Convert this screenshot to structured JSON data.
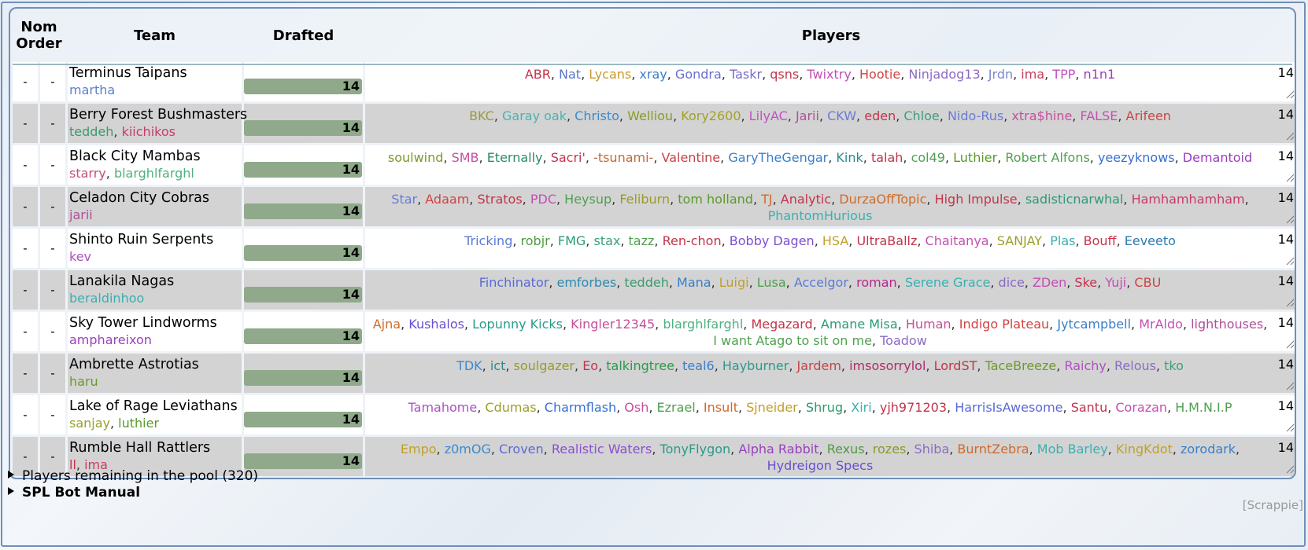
{
  "header": {
    "nom_order": [
      "Nom",
      "Order"
    ],
    "team": "Team",
    "drafted": "Drafted",
    "players": "Players"
  },
  "teams": [
    {
      "name": "Terminus Taipans",
      "nom_a": "-",
      "nom_b": "-",
      "coaches": [
        {
          "name": "martha",
          "color": "#5b7fd1"
        }
      ],
      "drafted": "14",
      "drafted_fraction": 1.0,
      "count": "14",
      "players": [
        {
          "name": "ABR",
          "color": "#c2344a"
        },
        {
          "name": "Nat",
          "color": "#5978c8"
        },
        {
          "name": "Lycans",
          "color": "#c89a2a"
        },
        {
          "name": "xray",
          "color": "#3a7fc9"
        },
        {
          "name": "Gondra",
          "color": "#6a6fd1"
        },
        {
          "name": "Taskr",
          "color": "#7a6ac6"
        },
        {
          "name": "qsns",
          "color": "#c2344a"
        },
        {
          "name": "Twixtry",
          "color": "#c44fb3"
        },
        {
          "name": "Hootie",
          "color": "#d04444"
        },
        {
          "name": "Ninjadog13",
          "color": "#8a6cc4"
        },
        {
          "name": "Jrdn",
          "color": "#7a8ad0"
        },
        {
          "name": "ima",
          "color": "#c93c5a"
        },
        {
          "name": "TPP",
          "color": "#c04fc0"
        },
        {
          "name": "n1n1",
          "color": "#9b3fbd"
        }
      ]
    },
    {
      "name": "Berry Forest Bushmasters",
      "nom_a": "-",
      "nom_b": "-",
      "coaches": [
        {
          "name": "teddeh",
          "color": "#3d9a6e"
        },
        {
          "name": "kiichikos",
          "color": "#c83b6a"
        }
      ],
      "drafted": "14",
      "drafted_fraction": 1.0,
      "count": "14",
      "players": [
        {
          "name": "BKC",
          "color": "#9a9a3a"
        },
        {
          "name": "Garay oak",
          "color": "#4fb0b0"
        },
        {
          "name": "Christo",
          "color": "#3a8ad0"
        },
        {
          "name": "Welliou",
          "color": "#8a9a2a"
        },
        {
          "name": "Kory2600",
          "color": "#a0a028"
        },
        {
          "name": "LilyAC",
          "color": "#c44fc4"
        },
        {
          "name": "Jarii",
          "color": "#b04f9a"
        },
        {
          "name": "CKW",
          "color": "#6a7ad6"
        },
        {
          "name": "eden",
          "color": "#c2344a"
        },
        {
          "name": "Chloe",
          "color": "#3aa07a"
        },
        {
          "name": "Nido-Rus",
          "color": "#6a7ad6"
        },
        {
          "name": "xtra$hine",
          "color": "#c44fa0"
        },
        {
          "name": "FALSE",
          "color": "#c44fb3"
        },
        {
          "name": "Arifeen",
          "color": "#d04444"
        }
      ]
    },
    {
      "name": "Black City Mambas",
      "nom_a": "-",
      "nom_b": "-",
      "coaches": [
        {
          "name": "starry",
          "color": "#c44f7a"
        },
        {
          "name": "blarghlfarghl",
          "color": "#4fb080"
        }
      ],
      "drafted": "14",
      "drafted_fraction": 1.0,
      "count": "14",
      "players": [
        {
          "name": "soulwind",
          "color": "#7a9a2a"
        },
        {
          "name": "SMB",
          "color": "#c44fa0"
        },
        {
          "name": "Eternally",
          "color": "#2a8a6a"
        },
        {
          "name": "Sacri'",
          "color": "#c2344a"
        },
        {
          "name": "-tsunami-",
          "color": "#c06a3a"
        },
        {
          "name": "Valentine",
          "color": "#c2444a"
        },
        {
          "name": "GaryTheGengar",
          "color": "#3a7fc9"
        },
        {
          "name": "Kink",
          "color": "#2a8a8a"
        },
        {
          "name": "talah",
          "color": "#c2344a"
        },
        {
          "name": "col49",
          "color": "#4fa050"
        },
        {
          "name": "Luthier",
          "color": "#5a9a2a"
        },
        {
          "name": "Robert Alfons",
          "color": "#4fa050"
        },
        {
          "name": "yeezyknows",
          "color": "#3a6fd1"
        },
        {
          "name": "Demantoid",
          "color": "#9b3fbd"
        }
      ]
    },
    {
      "name": "Celadon City Cobras",
      "nom_a": "-",
      "nom_b": "-",
      "coaches": [
        {
          "name": "jarii",
          "color": "#b04f9a"
        }
      ],
      "drafted": "14",
      "drafted_fraction": 1.0,
      "count": "14",
      "players": [
        {
          "name": "Star",
          "color": "#6a7ad6"
        },
        {
          "name": "Adaam",
          "color": "#d04444"
        },
        {
          "name": "Stratos",
          "color": "#c2344a"
        },
        {
          "name": "PDC",
          "color": "#c44fb3"
        },
        {
          "name": "Heysup",
          "color": "#4fa050"
        },
        {
          "name": "Feliburn",
          "color": "#9a9a2a"
        },
        {
          "name": "tom holland",
          "color": "#5a9a2a"
        },
        {
          "name": "TJ",
          "color": "#d06a2a"
        },
        {
          "name": "Analytic",
          "color": "#c2344a"
        },
        {
          "name": "DurzaOffTopic",
          "color": "#d06a2a"
        },
        {
          "name": "High Impulse",
          "color": "#c2344a"
        },
        {
          "name": "sadisticnarwhal",
          "color": "#2a9a7a"
        },
        {
          "name": "Hamhamhamham",
          "color": "#c83b6a"
        },
        {
          "name": "PhantomHurious",
          "color": "#3ab0b0"
        }
      ]
    },
    {
      "name": "Shinto Ruin Serpents",
      "nom_a": "-",
      "nom_b": "-",
      "coaches": [
        {
          "name": "kev",
          "color": "#b04fc4"
        }
      ],
      "drafted": "14",
      "drafted_fraction": 1.0,
      "count": "14",
      "players": [
        {
          "name": "Tricking",
          "color": "#5a7ad6"
        },
        {
          "name": "robjr",
          "color": "#4f9a40"
        },
        {
          "name": "FMG",
          "color": "#2a9a7a"
        },
        {
          "name": "stax",
          "color": "#3aa07a"
        },
        {
          "name": "tazz",
          "color": "#4fa050"
        },
        {
          "name": "Ren-chon",
          "color": "#c2344a"
        },
        {
          "name": "Bobby Dagen",
          "color": "#7a4fd1"
        },
        {
          "name": "HSA",
          "color": "#c0a02a"
        },
        {
          "name": "UltraBallz",
          "color": "#c2344a"
        },
        {
          "name": "Chaitanya",
          "color": "#c44fb3"
        },
        {
          "name": "SANJAY",
          "color": "#9aa02a"
        },
        {
          "name": "Plas",
          "color": "#3ab0b0"
        },
        {
          "name": "Bouff",
          "color": "#c2344a"
        },
        {
          "name": "Eeveeto",
          "color": "#2a7ab0"
        }
      ]
    },
    {
      "name": "Lanakila Nagas",
      "nom_a": "-",
      "nom_b": "-",
      "coaches": [
        {
          "name": "beraldinhoo",
          "color": "#3ab0b0"
        }
      ],
      "drafted": "14",
      "drafted_fraction": 1.0,
      "count": "14",
      "players": [
        {
          "name": "Finchinator",
          "color": "#5a6ad6"
        },
        {
          "name": "emforbes",
          "color": "#2a8ab0"
        },
        {
          "name": "teddeh",
          "color": "#3d9a6e"
        },
        {
          "name": "Mana",
          "color": "#3a7fc9"
        },
        {
          "name": "Luigi",
          "color": "#c0a02a"
        },
        {
          "name": "Lusa",
          "color": "#4fa050"
        },
        {
          "name": "Accelgor",
          "color": "#5a7ad6"
        },
        {
          "name": "roman",
          "color": "#b02a8a"
        },
        {
          "name": "Serene Grace",
          "color": "#3ab0b0"
        },
        {
          "name": "dice",
          "color": "#8a6cc4"
        },
        {
          "name": "ZDen",
          "color": "#c44fb3"
        },
        {
          "name": "Ske",
          "color": "#c2344a"
        },
        {
          "name": "Yuji",
          "color": "#c44fb3"
        },
        {
          "name": "CBU",
          "color": "#d04444"
        }
      ]
    },
    {
      "name": "Sky Tower Lindworms",
      "nom_a": "-",
      "nom_b": "-",
      "coaches": [
        {
          "name": "amphareixon",
          "color": "#9b3fbd"
        }
      ],
      "drafted": "14",
      "drafted_fraction": 1.0,
      "count": "14",
      "players": [
        {
          "name": "Ajna",
          "color": "#d06a2a"
        },
        {
          "name": "Kushalos",
          "color": "#6a4fd1"
        },
        {
          "name": "Lopunny Kicks",
          "color": "#2a9a8a"
        },
        {
          "name": "Kingler12345",
          "color": "#c44f9a"
        },
        {
          "name": "blarghlfarghl",
          "color": "#4fb080"
        },
        {
          "name": "Megazard",
          "color": "#c2344a"
        },
        {
          "name": "Amane Misa",
          "color": "#2a9a7a"
        },
        {
          "name": "Human",
          "color": "#c44f9a"
        },
        {
          "name": "Indigo Plateau",
          "color": "#d04444"
        },
        {
          "name": "Jytcampbell",
          "color": "#3a7fc9"
        },
        {
          "name": "MrAldo",
          "color": "#c44fb3"
        },
        {
          "name": "lighthouses",
          "color": "#b04f9a"
        },
        {
          "name": "I want Atago to sit on me",
          "color": "#4fa050"
        },
        {
          "name": "Toadow",
          "color": "#8a6cc4"
        }
      ]
    },
    {
      "name": "Ambrette Astrotias",
      "nom_a": "-",
      "nom_b": "-",
      "coaches": [
        {
          "name": "haru",
          "color": "#6a9a2a"
        }
      ],
      "drafted": "14",
      "drafted_fraction": 1.0,
      "count": "14",
      "players": [
        {
          "name": "TDK",
          "color": "#3a8ad0"
        },
        {
          "name": "ict",
          "color": "#2a8a8a"
        },
        {
          "name": "soulgazer",
          "color": "#9a9a2a"
        },
        {
          "name": "Eo",
          "color": "#c2344a"
        },
        {
          "name": "talkingtree",
          "color": "#2a9a4a"
        },
        {
          "name": "teal6",
          "color": "#3a7fc9"
        },
        {
          "name": "Hayburner",
          "color": "#2a9a8a"
        },
        {
          "name": "Jardem",
          "color": "#c2444a"
        },
        {
          "name": "imsosorrylol",
          "color": "#b02a6a"
        },
        {
          "name": "LordST",
          "color": "#c2344a"
        },
        {
          "name": "TaceBreeze",
          "color": "#6a9a2a"
        },
        {
          "name": "Raichy",
          "color": "#b04fc4"
        },
        {
          "name": "Relous",
          "color": "#8a6cc4"
        },
        {
          "name": "tko",
          "color": "#3aa07a"
        }
      ]
    },
    {
      "name": "Lake of Rage Leviathans",
      "nom_a": "-",
      "nom_b": "-",
      "coaches": [
        {
          "name": "sanjay",
          "color": "#9aa02a"
        },
        {
          "name": "luthier",
          "color": "#5a9a2a"
        }
      ],
      "drafted": "14",
      "drafted_fraction": 1.0,
      "count": "14",
      "players": [
        {
          "name": "Tamahome",
          "color": "#b04fc4"
        },
        {
          "name": "Cdumas",
          "color": "#9aa02a"
        },
        {
          "name": "Charmflash",
          "color": "#3a6fd1"
        },
        {
          "name": "Osh",
          "color": "#c44f9a"
        },
        {
          "name": "Ezrael",
          "color": "#4fa050"
        },
        {
          "name": "Insult",
          "color": "#d06a2a"
        },
        {
          "name": "Sjneider",
          "color": "#c0a02a"
        },
        {
          "name": "Shrug",
          "color": "#2a9a6a"
        },
        {
          "name": "Xiri",
          "color": "#3ab0b0"
        },
        {
          "name": "yjh971203",
          "color": "#c2344a"
        },
        {
          "name": "HarrisIsAwesome",
          "color": "#5a6ad6"
        },
        {
          "name": "Santu",
          "color": "#c2344a"
        },
        {
          "name": "Corazan",
          "color": "#c44fb3"
        },
        {
          "name": "H.M.N.I.P",
          "color": "#4fa050"
        }
      ]
    },
    {
      "name": "Rumble Hall Rattlers",
      "nom_a": "-",
      "nom_b": "-",
      "coaches": [
        {
          "name": "ll",
          "color": "#c2344a"
        },
        {
          "name": "ima",
          "color": "#c93c5a"
        }
      ],
      "drafted": "14",
      "drafted_fraction": 1.0,
      "count": "14",
      "players": [
        {
          "name": "Empo",
          "color": "#c0a02a"
        },
        {
          "name": "z0mOG",
          "color": "#3a8ad0"
        },
        {
          "name": "Croven",
          "color": "#5a6ad6"
        },
        {
          "name": "Realistic Waters",
          "color": "#8a4fd1"
        },
        {
          "name": "TonyFlygon",
          "color": "#2a9a8a"
        },
        {
          "name": "Alpha Rabbit",
          "color": "#9b3fbd"
        },
        {
          "name": "Rexus",
          "color": "#4f9a40"
        },
        {
          "name": "rozes",
          "color": "#8a9a2a"
        },
        {
          "name": "Shiba",
          "color": "#8a6cc4"
        },
        {
          "name": "BurntZebra",
          "color": "#d06a2a"
        },
        {
          "name": "Mob Barley",
          "color": "#3ab0b0"
        },
        {
          "name": "KingKdot",
          "color": "#c0a02a"
        },
        {
          "name": "zorodark",
          "color": "#3a7fc9"
        },
        {
          "name": "Hydreigon Specs",
          "color": "#6a4fd1"
        }
      ]
    }
  ],
  "footer": {
    "pool_label": "Players remaining in the pool (320)",
    "manual_label": "SPL Bot Manual",
    "credit": "[Scrappie]"
  },
  "colors": {
    "bar": "#8fa98a",
    "alt_row": "#d3d3d3",
    "border": "#6f8fb8"
  },
  "icons": {
    "disclosure": "disclosure-triangle-icon",
    "resize": "resize-grip-icon"
  }
}
